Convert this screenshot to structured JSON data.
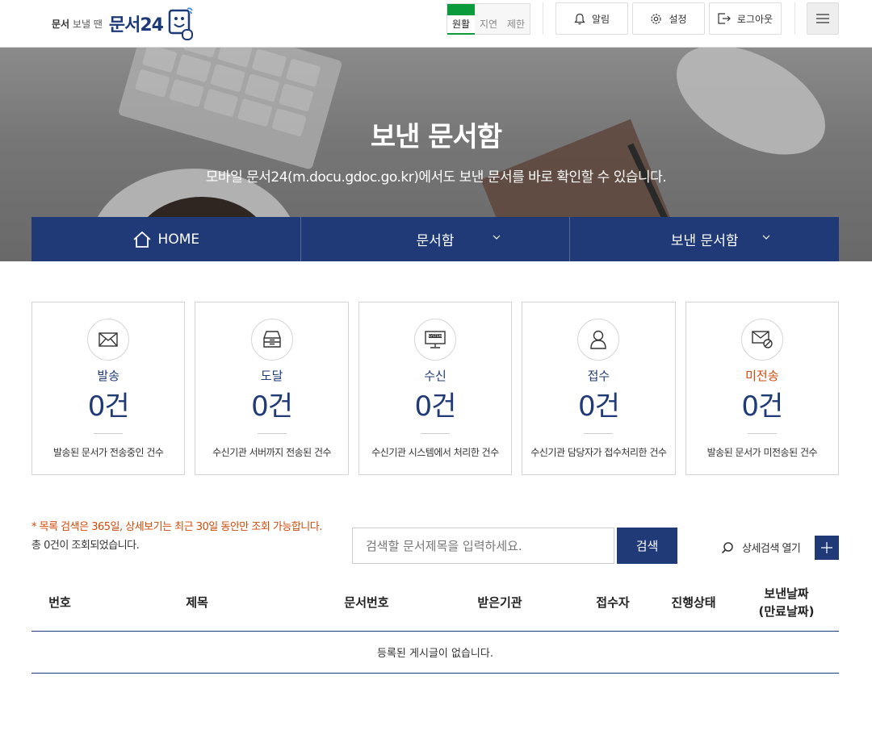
{
  "header": {
    "logo_small_bold": "문서",
    "logo_small_rest": " 보낼 땐",
    "logo_big": "문서24",
    "status": [
      "원활",
      "지연",
      "제한"
    ],
    "alarm_label": "알림",
    "settings_label": "설정",
    "logout_label": "로그아웃"
  },
  "hero": {
    "title": "보낸 문서함",
    "subtitle": "모바일 문서24(m.docu.gdoc.go.kr)에서도 보낸 문서를 바로 확인할 수 있습니다."
  },
  "nav": {
    "home": "HOME",
    "menu1": "문서함",
    "menu2": "보낸 문서함"
  },
  "cards": [
    {
      "icon": "envelope-icon",
      "label": "발송",
      "count": "0건",
      "desc": "발송된 문서가 전송중인 건수"
    },
    {
      "icon": "inbox-tray-icon",
      "label": "도달",
      "count": "0건",
      "desc": "수신기관 서버까지 전송된 건수"
    },
    {
      "icon": "system-monitor-icon",
      "label": "수신",
      "count": "0건",
      "desc": "수신기관 시스템에서 처리한 건수"
    },
    {
      "icon": "person-icon",
      "label": "접수",
      "count": "0건",
      "desc": "수신기관 담당자가 접수처리한 건수"
    },
    {
      "icon": "envelope-blocked-icon",
      "label": "미전송",
      "count": "0건",
      "desc": "발송된 문서가 미전송된 건수"
    }
  ],
  "search": {
    "notice": "* 목록 검색은 365일, 상세보기는 최근 30일 동안만 조회 가능합니다.",
    "total": "총 0건이 조회되었습니다.",
    "placeholder": "검색할 문서제목을 입력하세요.",
    "button": "검색",
    "advanced": "상세검색 열기"
  },
  "table": {
    "headers": [
      "번호",
      "제목",
      "문서번호",
      "받은기관",
      "접수자",
      "진행상태",
      "보낸날짜",
      "(만료날짜)"
    ],
    "empty": "등록된 게시글이 없습니다."
  },
  "colors": {
    "primary": "#1f3a76",
    "warning": "#d14a0a",
    "status_ok": "#0b9b3a"
  }
}
